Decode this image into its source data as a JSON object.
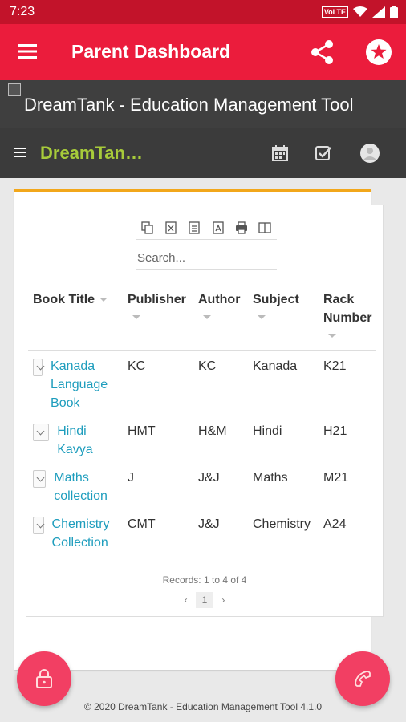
{
  "status_bar": {
    "time": "7:23",
    "network": "VoLTE"
  },
  "app_bar": {
    "title": "Parent Dashboard",
    "icons": [
      "menu-icon",
      "share-icon",
      "star-icon"
    ]
  },
  "banner": {
    "alt_text": "DreamTank - Education Management Tool"
  },
  "sub_nav": {
    "brand": "DreamTan…",
    "icons": [
      "menu-icon",
      "calendar-icon",
      "checkbox-icon",
      "avatar"
    ]
  },
  "table_tools": {
    "buttons": [
      "copy",
      "excel",
      "csv",
      "pdf",
      "print",
      "column-visibility"
    ],
    "search_placeholder": "Search..."
  },
  "table": {
    "columns": [
      "Book Title",
      "Publisher",
      "Author",
      "Subject",
      "Rack Number"
    ],
    "rows": [
      {
        "title": "Kanada Language Book",
        "publisher": "KC",
        "author": "KC",
        "subject": "Kanada",
        "rack": "K21"
      },
      {
        "title": "Hindi Kavya",
        "publisher": "HMT",
        "author": "H&M",
        "subject": "Hindi",
        "rack": "H21"
      },
      {
        "title": "Maths collection",
        "publisher": "J",
        "author": "J&J",
        "subject": "Maths",
        "rack": "M21"
      },
      {
        "title": "Chemistry Collection",
        "publisher": "CMT",
        "author": "J&J",
        "subject": "Chemistry",
        "rack": "A24"
      }
    ]
  },
  "pagination": {
    "records": "Records: 1 to 4 of 4",
    "current_page": "1",
    "prev": "‹",
    "next": "›"
  },
  "fabs": {
    "left": "lock-icon",
    "right": "phone-icon"
  },
  "footer": {
    "text": "© 2020 DreamTank - Education Management Tool 4.1.0"
  },
  "colors": {
    "status_bar": "#c2132a",
    "app_bar": "#eb1c3c",
    "banner": "#3f3f3f",
    "brand": "#a7cb3a",
    "accent_line": "#f2a71b",
    "link": "#1e9dbd",
    "fab": "#f23f63"
  }
}
